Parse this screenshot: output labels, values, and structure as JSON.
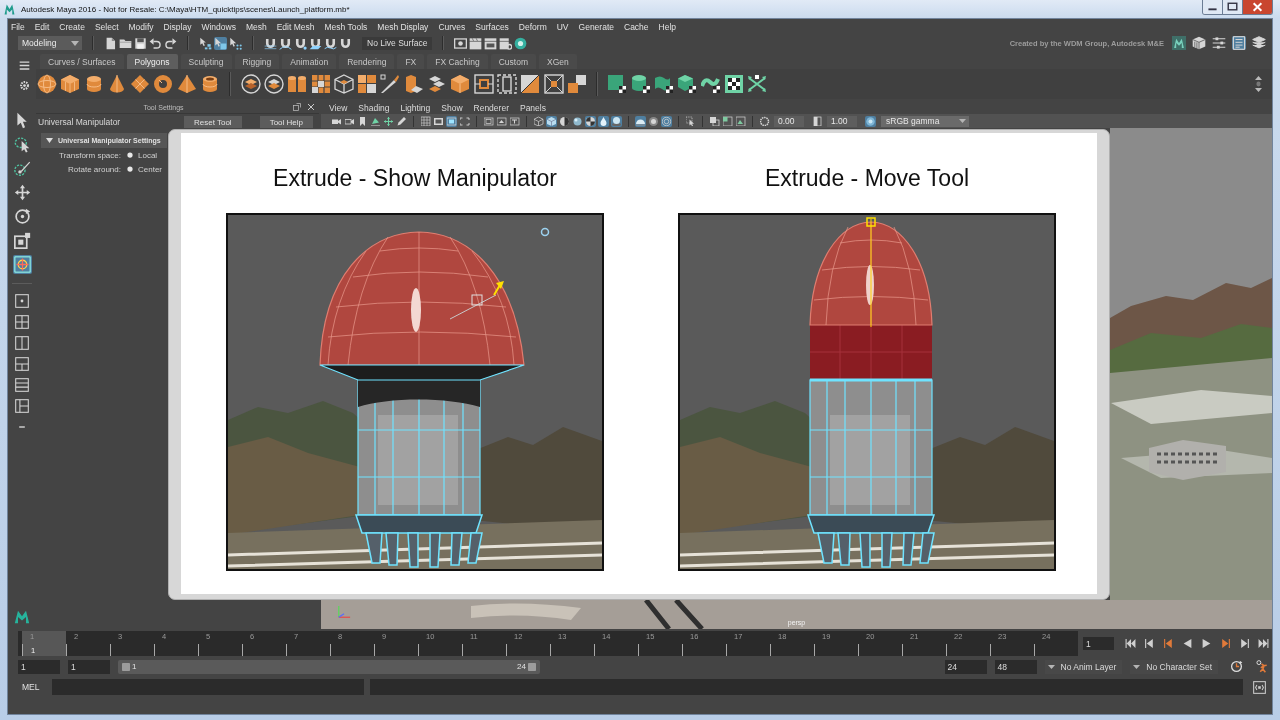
{
  "window": {
    "title": "Autodesk Maya 2016 - Not for Resale: C:\\Maya\\HTM_quicktips\\scenes\\Launch_platform.mb*"
  },
  "menu_bar": [
    "File",
    "Edit",
    "Create",
    "Select",
    "Modify",
    "Display",
    "Windows",
    "Mesh",
    "Edit Mesh",
    "Mesh Tools",
    "Mesh Display",
    "Curves",
    "Surfaces",
    "Deform",
    "UV",
    "Generate",
    "Cache",
    "Help"
  ],
  "status_line": {
    "menu_set": "Modeling",
    "select_modes": [
      {
        "kind": "hierarchy",
        "selected": false
      },
      {
        "kind": "object",
        "selected": true
      },
      {
        "kind": "component",
        "selected": false
      }
    ],
    "live_surface": "No Live Surface",
    "credit": "Created by the WDM Group, Autodesk M&E",
    "panels": [
      {
        "kind": "toolkit",
        "selected": false
      },
      {
        "kind": "attributes",
        "selected": false
      },
      {
        "kind": "toolsettings",
        "selected": true
      },
      {
        "kind": "channels",
        "selected": false
      }
    ]
  },
  "shelf": {
    "tabs": [
      {
        "label": "Curves / Surfaces",
        "selected": false
      },
      {
        "label": "Polygons",
        "selected": true
      },
      {
        "label": "Sculpting",
        "selected": false
      },
      {
        "label": "Rigging",
        "selected": false
      },
      {
        "label": "Animation",
        "selected": false
      },
      {
        "label": "Rendering",
        "selected": false
      },
      {
        "label": "FX",
        "selected": false
      },
      {
        "label": "FX Caching",
        "selected": false
      },
      {
        "label": "Custom",
        "selected": false
      },
      {
        "label": "XGen",
        "selected": false
      }
    ]
  },
  "toolbox": [
    {
      "kind": "select",
      "selected": false
    },
    {
      "kind": "lasso",
      "selected": false
    },
    {
      "kind": "paint",
      "selected": false
    },
    {
      "kind": "move",
      "selected": false
    },
    {
      "kind": "rotate",
      "selected": false
    },
    {
      "kind": "scale",
      "selected": false
    },
    {
      "kind": "universal",
      "selected": true
    }
  ],
  "tool_settings": {
    "header": "Tool Settings",
    "tool": "Universal Manipulator",
    "buttons": [
      "Reset Tool",
      "Tool Help"
    ],
    "section": {
      "title": "Universal Manipulator Settings",
      "expanded": true,
      "options": [
        {
          "label": "Transform space:",
          "value": "Local",
          "selected": true
        },
        {
          "label": "Rotate around:",
          "value": "Center",
          "selected": true
        }
      ]
    }
  },
  "viewport": {
    "menu": [
      "View",
      "Shading",
      "Lighting",
      "Show",
      "Renderer",
      "Panels"
    ],
    "toolbar": [
      [
        {
          "kind": "camera",
          "on": false
        },
        {
          "kind": "cameraframe",
          "on": false
        },
        {
          "kind": "bookmark",
          "on": false
        },
        {
          "kind": "imageplane",
          "on": false
        },
        {
          "kind": "pan",
          "on": false
        },
        {
          "kind": "pencil",
          "on": false
        }
      ],
      [
        {
          "kind": "grid",
          "on": false
        },
        {
          "kind": "film",
          "on": false
        },
        {
          "kind": "frame",
          "on": true
        },
        {
          "kind": "gate",
          "on": false
        }
      ],
      [
        {
          "kind": "safe",
          "on": false
        },
        {
          "kind": "field",
          "on": false
        },
        {
          "kind": "title",
          "on": false
        }
      ],
      [
        {
          "kind": "wire",
          "on": false
        },
        {
          "kind": "shaded",
          "on": true
        },
        {
          "kind": "halftone",
          "on": false
        },
        {
          "kind": "sphere",
          "on": false
        },
        {
          "kind": "checker",
          "on": true
        },
        {
          "kind": "light",
          "on": true
        },
        {
          "kind": "shadow",
          "on": true
        }
      ],
      [
        {
          "kind": "occlusion",
          "on": true
        },
        {
          "kind": "blur",
          "on": false
        },
        {
          "kind": "smooth",
          "on": true
        }
      ],
      [
        {
          "kind": "isolate",
          "on": false
        }
      ],
      [
        {
          "kind": "xray",
          "on": false
        },
        {
          "kind": "joints",
          "on": false
        },
        {
          "kind": "components",
          "on": false
        }
      ]
    ],
    "exposure": "0.00",
    "gamma": "1.00",
    "color_management": {
      "on": true,
      "view": "sRGB gamma"
    },
    "camera": "persp"
  },
  "slide": {
    "panels": [
      {
        "title": "Extrude - Show Manipulator",
        "kind": "dome"
      },
      {
        "title": "Extrude - Move Tool",
        "kind": "extruded"
      }
    ]
  },
  "time_slider": {
    "frames": [
      {
        "label": "1",
        "selected": true
      },
      {
        "label": "2",
        "selected": false
      },
      {
        "label": "3",
        "selected": false
      },
      {
        "label": "4",
        "selected": false
      },
      {
        "label": "5",
        "selected": false
      },
      {
        "label": "6",
        "selected": false
      },
      {
        "label": "7",
        "selected": false
      },
      {
        "label": "8",
        "selected": false
      },
      {
        "label": "9",
        "selected": false
      },
      {
        "label": "10",
        "selected": false
      },
      {
        "label": "11",
        "selected": false
      },
      {
        "label": "12",
        "selected": false
      },
      {
        "label": "13",
        "selected": false
      },
      {
        "label": "14",
        "selected": false
      },
      {
        "label": "15",
        "selected": false
      },
      {
        "label": "16",
        "selected": false
      },
      {
        "label": "17",
        "selected": false
      },
      {
        "label": "18",
        "selected": false
      },
      {
        "label": "19",
        "selected": false
      },
      {
        "label": "20",
        "selected": false
      },
      {
        "label": "21",
        "selected": false
      },
      {
        "label": "22",
        "selected": false
      },
      {
        "label": "23",
        "selected": false
      },
      {
        "label": "24",
        "selected": false
      }
    ],
    "current_label": "1",
    "current_frame": "1"
  },
  "range_slider": {
    "start": "1",
    "playback_start": "1",
    "bar_start": "1",
    "bar_end": "24",
    "playback_end": "24",
    "end": "48",
    "anim_layer": "No Anim Layer",
    "character_set": "No Character Set"
  },
  "command_line": {
    "language": "MEL"
  }
}
